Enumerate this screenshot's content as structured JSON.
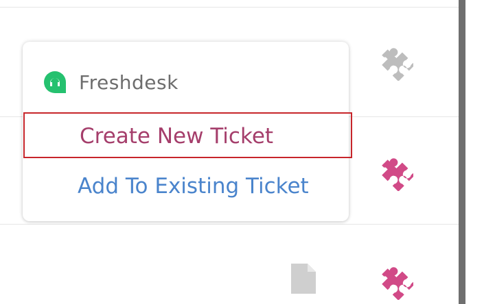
{
  "background_icons": {
    "row_icons": [
      "puzzle-piece-icon",
      "puzzle-piece-icon",
      "puzzle-piece-icon"
    ],
    "attachment_icon": "document-icon"
  },
  "colors": {
    "puzzle_inactive": "#bdbdbd",
    "puzzle_active": "#d14a87",
    "freshdesk_green": "#25c16f",
    "create_ticket_text": "#a53e6b",
    "add_ticket_text": "#4a84cc",
    "focus_outline": "#c7252a"
  },
  "dropdown": {
    "app_name": "Freshdesk",
    "app_icon": "freshdesk-logo-icon",
    "items": [
      {
        "label": "Create New Ticket",
        "focused": true
      },
      {
        "label": "Add To Existing Ticket",
        "focused": false
      }
    ]
  }
}
